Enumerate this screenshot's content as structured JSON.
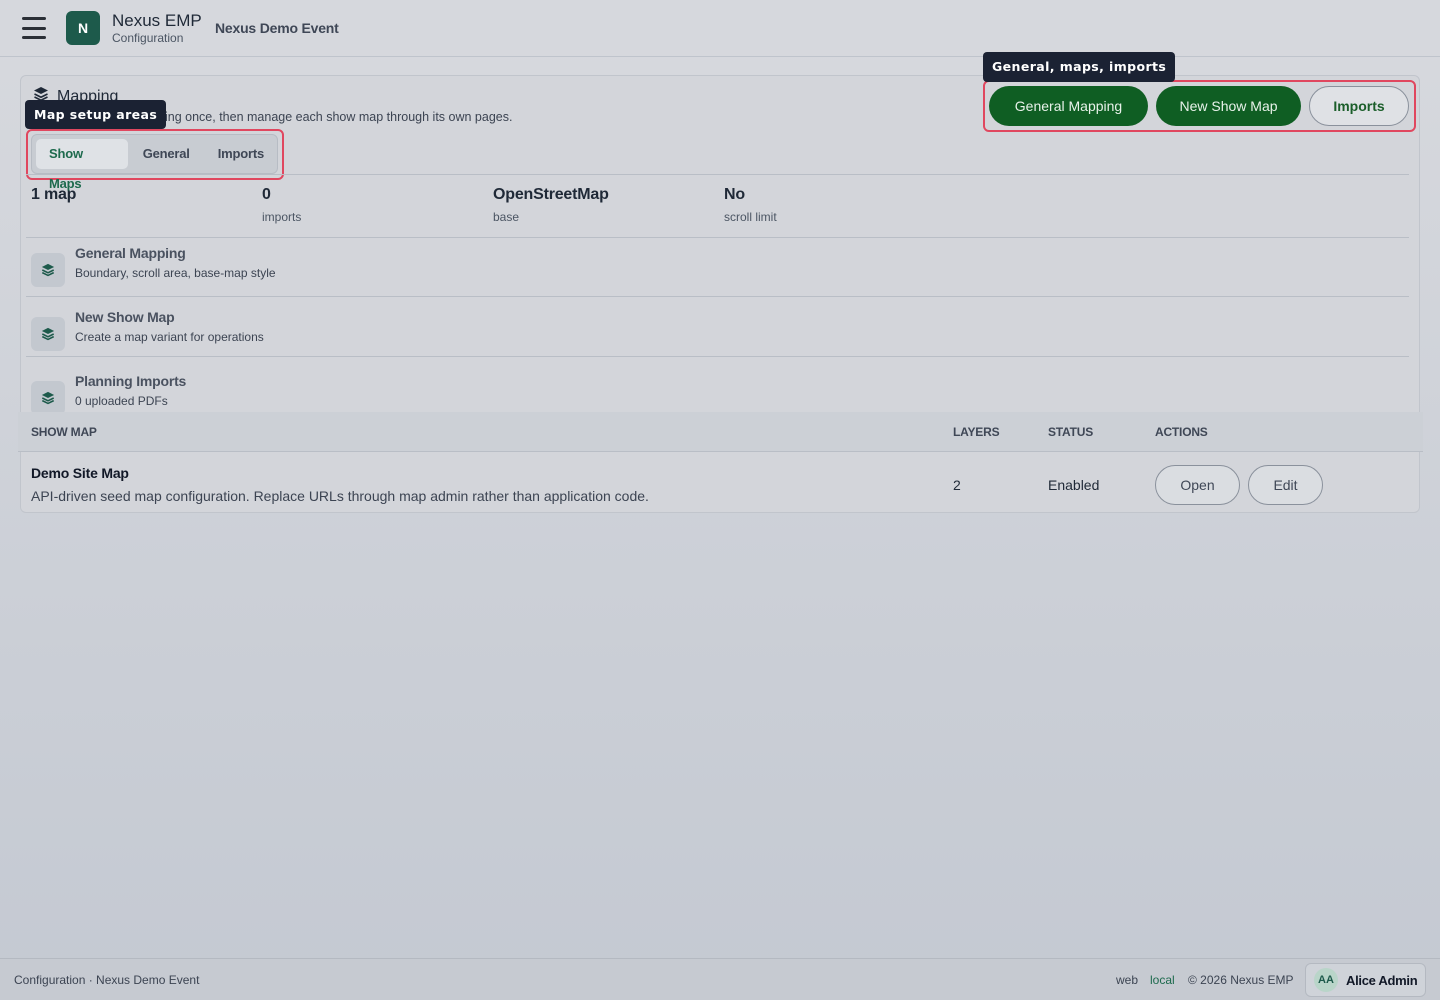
{
  "header": {
    "logo_letter": "N",
    "app_name": "Nexus EMP",
    "app_section": "Configuration",
    "event_name": "Nexus Demo Event"
  },
  "card": {
    "title": "Mapping",
    "description": "ing once, then manage each show map through its own pages.",
    "tooltip_tabs": "Map setup areas",
    "tooltip_actions": "General, maps, imports",
    "tabs": [
      {
        "label": "Show Maps",
        "active": true
      },
      {
        "label": "General",
        "active": false
      },
      {
        "label": "Imports",
        "active": false
      }
    ],
    "actions": {
      "general": "General Mapping",
      "new_map": "New Show Map",
      "imports": "Imports"
    },
    "stats": [
      {
        "value": "1 map",
        "label": ""
      },
      {
        "value": "0",
        "label": "imports"
      },
      {
        "value": "OpenStreetMap",
        "label": "base"
      },
      {
        "value": "No",
        "label": "scroll limit"
      }
    ],
    "nav_items": [
      {
        "title": "General Mapping",
        "subtitle": "Boundary, scroll area, base-map style"
      },
      {
        "title": "New Show Map",
        "subtitle": "Create a map variant for operations"
      },
      {
        "title": "Planning Imports",
        "subtitle": "0 uploaded PDFs"
      }
    ]
  },
  "table": {
    "columns": [
      "SHOW MAP",
      "LAYERS",
      "STATUS",
      "ACTIONS"
    ],
    "rows": [
      {
        "name": "Demo Site Map",
        "description": "API-driven seed map configuration. Replace URLs through map admin rather than application code.",
        "layers": "2",
        "status": "Enabled",
        "open": "Open",
        "edit": "Edit"
      }
    ]
  },
  "footer": {
    "left": "Configuration · Nexus Demo Event",
    "web": "web",
    "local": "local",
    "copyright": "© 2026 Nexus EMP",
    "user_initials": "AA",
    "user_name": "Alice Admin"
  },
  "colors": {
    "accent_green": "#0f5e23",
    "highlight_red": "#e0475f",
    "tooltip_bg": "#1b2233"
  },
  "icons": {
    "menu": "hamburger-icon",
    "section": "layers-icon"
  }
}
